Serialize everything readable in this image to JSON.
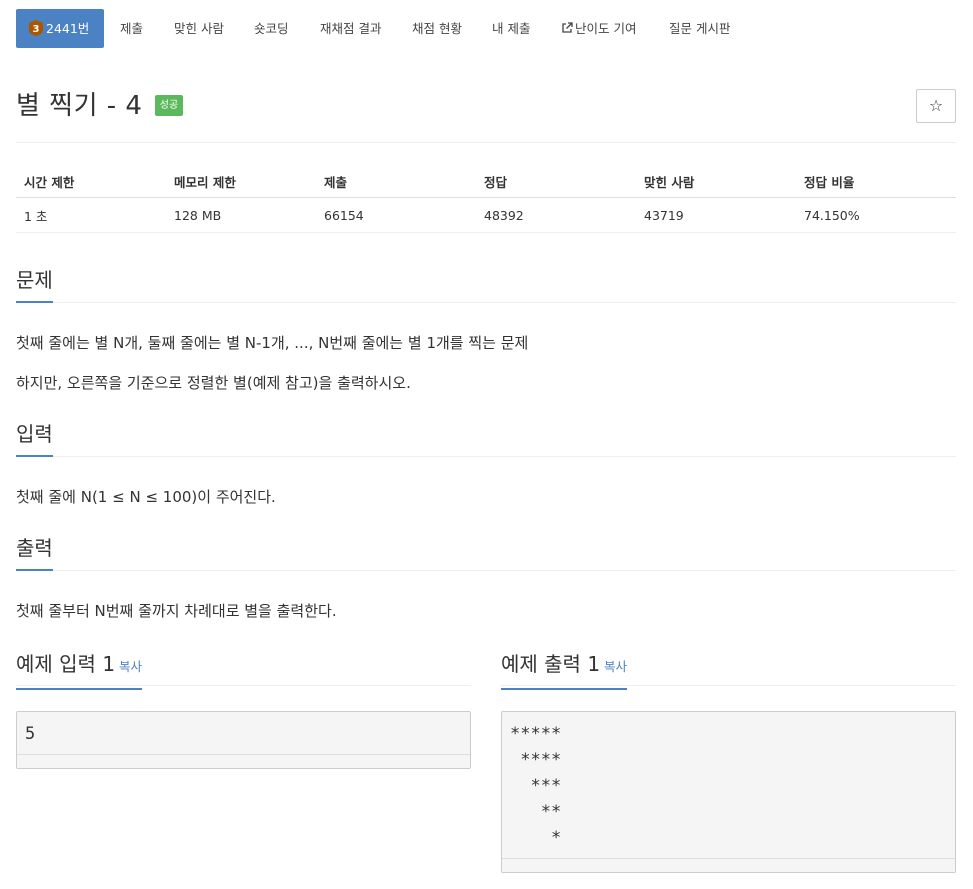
{
  "nav": {
    "tabs": [
      {
        "label": "2441번",
        "active": true,
        "tier": "3"
      },
      {
        "label": "제출"
      },
      {
        "label": "맞힌 사람"
      },
      {
        "label": "숏코딩"
      },
      {
        "label": "재채점 결과"
      },
      {
        "label": "채점 현황"
      },
      {
        "label": "내 제출"
      },
      {
        "label": "난이도 기여",
        "icon": "external-link-icon"
      },
      {
        "label": "질문 게시판"
      }
    ]
  },
  "problem": {
    "title": "별 찍기 - 4",
    "status_badge": "성공",
    "favorite_icon": "☆"
  },
  "info_table": {
    "headers": [
      "시간 제한",
      "메모리 제한",
      "제출",
      "정답",
      "맞힌 사람",
      "정답 비율"
    ],
    "values": [
      "1 초",
      "128 MB",
      "66154",
      "48392",
      "43719",
      "74.150%"
    ]
  },
  "sections": {
    "description": {
      "title": "문제",
      "lines": [
        "첫째 줄에는 별 N개, 둘째 줄에는 별 N-1개, ..., N번째 줄에는 별 1개를 찍는 문제",
        "하지만, 오른쪽을 기준으로 정렬한 별(예제 참고)을 출력하시오."
      ]
    },
    "input": {
      "title": "입력",
      "text": "첫째 줄에 N(1 ≤ N ≤ 100)이 주어진다."
    },
    "output": {
      "title": "출력",
      "text": "첫째 줄부터 N번째 줄까지 차례대로 별을 출력한다."
    }
  },
  "samples": {
    "input": {
      "title": "예제 입력 1",
      "copy_label": "복사",
      "content": "5"
    },
    "output": {
      "title": "예제 출력 1",
      "copy_label": "복사",
      "content": "*****\n ****\n  ***\n   **\n    *"
    }
  },
  "colors": {
    "accent": "#4b82c3",
    "success": "#5cb85c",
    "tier_bronze": "#ad5600"
  }
}
